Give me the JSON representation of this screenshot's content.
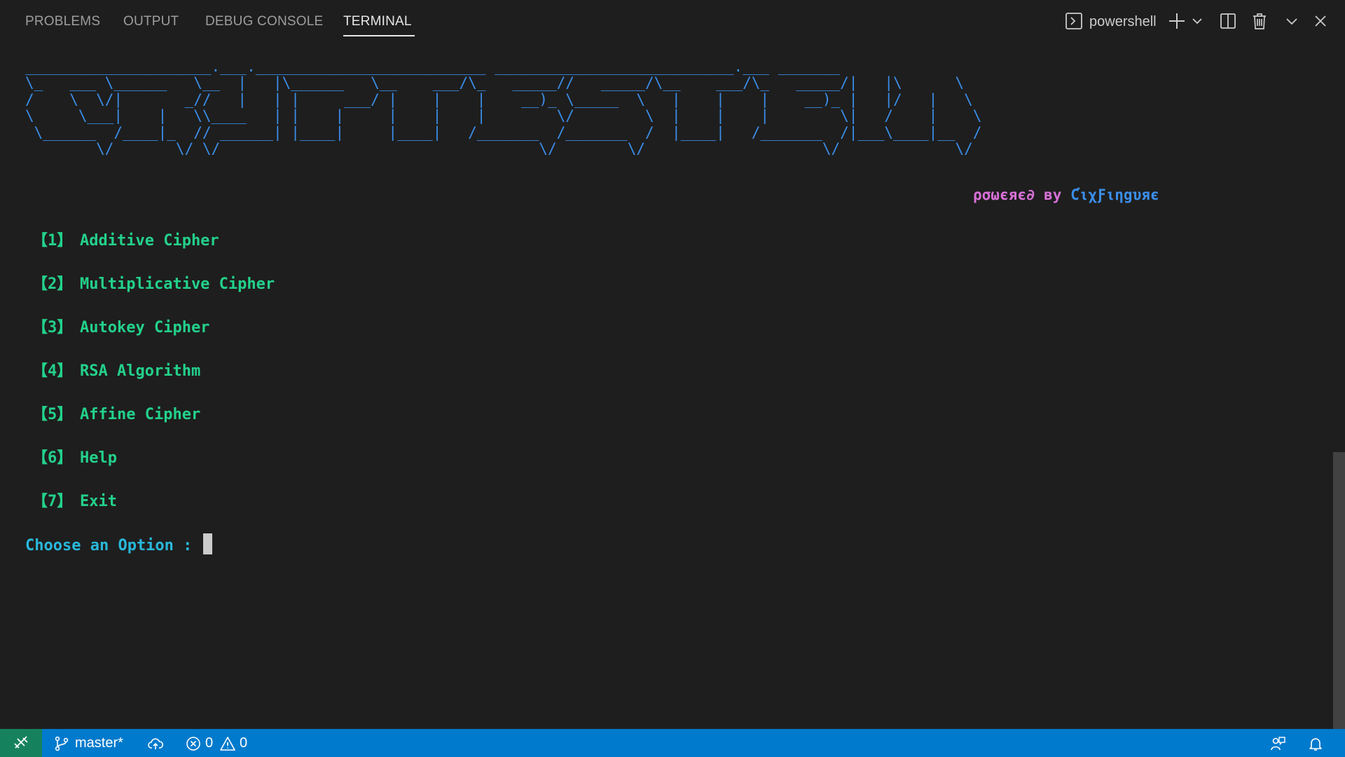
{
  "panel_tabs": [
    {
      "label": "PROBLEMS"
    },
    {
      "label": "OUTPUT"
    },
    {
      "label": "DEBUG CONSOLE"
    },
    {
      "label": "TERMINAL"
    }
  ],
  "terminal_toolbar": {
    "shell_name": "powershell",
    "icons": [
      "terminal-icon",
      "plus-icon",
      "chevron-down-icon",
      "split-icon",
      "trash-icon",
      "chevron-down-icon",
      "close-icon"
    ]
  },
  "banner_art": "_____________________.___.__________________________ ___________________________.___ _______\n\\_   ___ \\______   \\__  |   |\\______   \\__    ___/\\_   _____//   _____/\\__    ___/\\_   _____/|   |\\      \\\n/    \\  \\/|       _//   |   | |     ___/ |    |    |    __)_ \\_____  \\   |    |    |    __)_ |   |/   |   \\\n\\     \\___|    |   \\\\____   | |    |     |    |    |        \\/        \\  |    |    |        \\|   /    |    \\\n \\______  /____|_  // ______| |____|     |____|   /_______  /_______  /  |____|   /_______  /|___\\____|__  /\n        \\/       \\/ \\/                                    \\/        \\/                    \\/             \\/",
  "powered_by": {
    "prefix": "ρσωєяє∂ ву ",
    "author": "ƇιχƑιηgυяє"
  },
  "menu": [
    {
      "num": "【1】",
      "label": "Additive Cipher"
    },
    {
      "num": "【2】",
      "label": "Multiplicative Cipher"
    },
    {
      "num": "【3】",
      "label": "Autokey Cipher"
    },
    {
      "num": "【4】",
      "label": "RSA Algorithm"
    },
    {
      "num": "【5】",
      "label": "Affine Cipher"
    },
    {
      "num": "【6】",
      "label": "Help"
    },
    {
      "num": "【7】",
      "label": "Exit"
    }
  ],
  "prompt": "Choose an Option : ",
  "status_bar": {
    "branch": "master*",
    "errors": "0",
    "warnings": "0"
  },
  "colors": {
    "background": "#1e1e1e",
    "banner": "#3b8eea",
    "menu": "#23d18b",
    "prompt": "#29b8db",
    "powered": "#d670d6",
    "status_bar": "#007acc",
    "remote": "#16825d"
  }
}
